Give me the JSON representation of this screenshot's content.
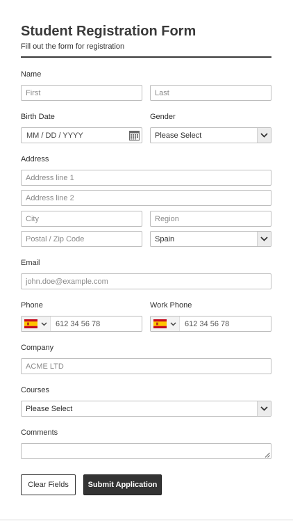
{
  "header": {
    "title": "Student Registration Form",
    "subtitle": "Fill out the form for registration"
  },
  "name": {
    "label": "Name",
    "first_placeholder": "First",
    "last_placeholder": "Last"
  },
  "birth_date": {
    "label": "Birth Date",
    "placeholder": "MM / DD / YYYY",
    "icon": "calendar-icon"
  },
  "gender": {
    "label": "Gender",
    "selected": "Please Select",
    "icon": "chevron-down-icon"
  },
  "address": {
    "label": "Address",
    "line1_placeholder": "Address line 1",
    "line2_placeholder": "Address line 2",
    "city_placeholder": "City",
    "region_placeholder": "Region",
    "zip_placeholder": "Postal / Zip Code",
    "country_selected": "Spain"
  },
  "email": {
    "label": "Email",
    "placeholder": "john.doe@example.com"
  },
  "phone": {
    "label": "Phone",
    "placeholder": "612 34 56 78",
    "flag": "spain-flag-icon"
  },
  "work_phone": {
    "label": "Work Phone",
    "placeholder": "612 34 56 78",
    "flag": "spain-flag-icon"
  },
  "company": {
    "label": "Company",
    "placeholder": "ACME LTD"
  },
  "courses": {
    "label": "Courses",
    "selected": "Please Select"
  },
  "comments": {
    "label": "Comments"
  },
  "buttons": {
    "clear": "Clear Fields",
    "submit": "Submit Application"
  },
  "colors": {
    "heading": "#3a3a3a",
    "submit_bg": "#333333",
    "border": "#bdbdbd",
    "flag_red": "#c60b1e",
    "flag_yellow": "#ffc400"
  }
}
